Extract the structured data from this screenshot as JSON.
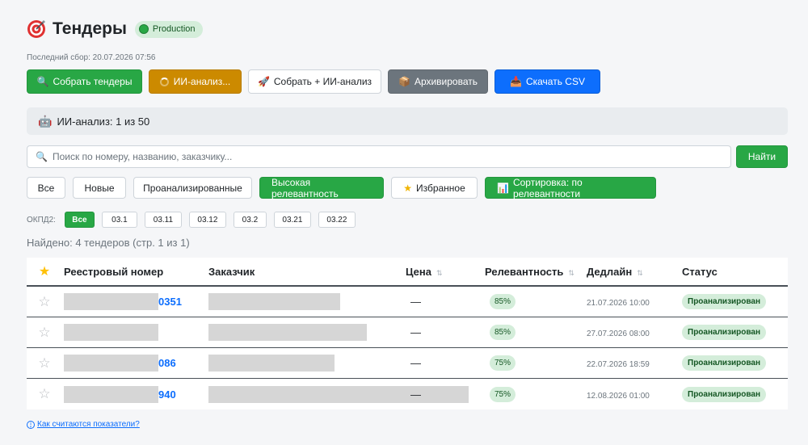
{
  "header": {
    "title": "Тендеры",
    "env_badge": "Production",
    "last_fetch": "Последний сбор: 20.07.2026 07:56"
  },
  "actions": {
    "collect": "Собрать тендеры",
    "ai_analysis": "ИИ-анализ...",
    "collect_ai": "Собрать + ИИ-анализ",
    "archive": "Архивировать",
    "download_csv": "Скачать CSV"
  },
  "ai_status": "ИИ-анализ: 1 из 50",
  "search": {
    "placeholder": "Поиск по номеру, названию, заказчику...",
    "value": "",
    "button": "Найти"
  },
  "filters": [
    {
      "label": "Все",
      "active": false
    },
    {
      "label": "Новые",
      "active": false
    },
    {
      "label": "Проанализированные",
      "active": false
    },
    {
      "label": "Высокая релевантность",
      "active": true
    },
    {
      "label": "Избранное",
      "active": false,
      "icon": "star-icon"
    },
    {
      "label": "Сортировка: по релевантности",
      "active": true,
      "icon": "chart-icon"
    }
  ],
  "okpd": {
    "label": "ОКПД2:",
    "items": [
      {
        "label": "Все",
        "active": true
      },
      {
        "label": "03.1",
        "active": false
      },
      {
        "label": "03.11",
        "active": false
      },
      {
        "label": "03.12",
        "active": false
      },
      {
        "label": "03.2",
        "active": false
      },
      {
        "label": "03.21",
        "active": false
      },
      {
        "label": "03.22",
        "active": false
      }
    ]
  },
  "found": "Найдено: 4 тендеров (стр. 1 из 1)",
  "table": {
    "columns": {
      "number": "Реестровый номер",
      "customer": "Заказчик",
      "price": "Цена",
      "relevance": "Релевантность",
      "deadline": "Дедлайн",
      "status": "Статус"
    },
    "sort_glyph": "⇅",
    "rows": [
      {
        "number_suffix": "0351",
        "price": "—",
        "relevance": "85%",
        "deadline": "21.07.2026 10:00",
        "status": "Проанализирован"
      },
      {
        "number_suffix": "",
        "price": "—",
        "relevance": "85%",
        "deadline": "27.07.2026 08:00",
        "status": "Проанализирован"
      },
      {
        "number_suffix": "086",
        "price": "—",
        "relevance": "75%",
        "deadline": "22.07.2026 18:59",
        "status": "Проанализирован"
      },
      {
        "number_suffix": "940",
        "price": "—",
        "relevance": "75%",
        "deadline": "12.08.2026 01:00",
        "status": "Проанализирован"
      }
    ]
  },
  "help_link": "Как считаются показатели?",
  "colors": {
    "green": "#28a745",
    "orange": "#cc8a00",
    "gray": "#6c757d",
    "blue": "#0d6efd",
    "badge_bg": "#d4edda",
    "badge_text": "#155724"
  }
}
